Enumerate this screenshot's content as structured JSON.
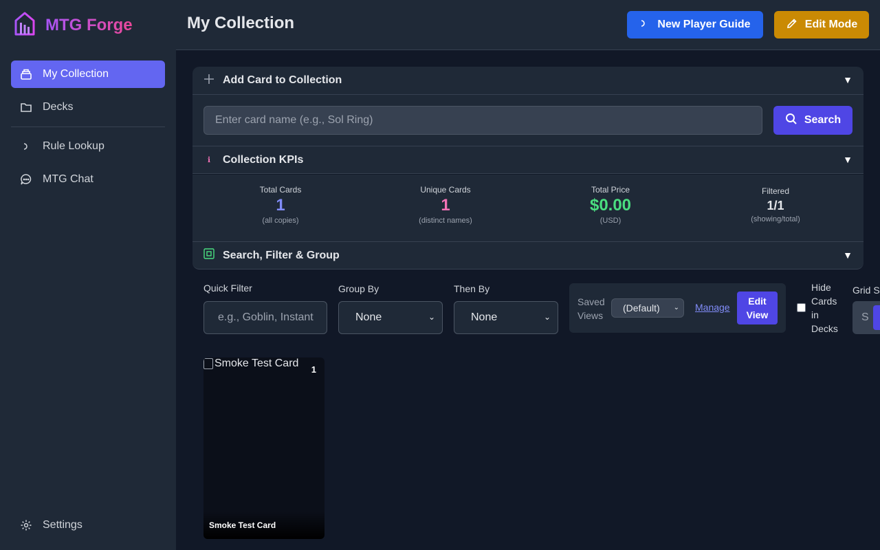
{
  "app": {
    "brand": "MTG Forge",
    "accent": "#6366f1"
  },
  "sidebar": {
    "items": [
      {
        "label": "My Collection",
        "icon": "collection-icon",
        "active": true
      },
      {
        "label": "Decks",
        "icon": "folder-icon"
      },
      {
        "label": "Rule Lookup",
        "icon": "refresh-icon"
      },
      {
        "label": "MTG Chat",
        "icon": "chat-icon"
      }
    ],
    "settings": "Settings"
  },
  "header": {
    "title": "My Collection",
    "guide_button": "New Player Guide",
    "edit_button": "Edit Mode"
  },
  "add_card": {
    "title": "Add Card to Collection",
    "placeholder": "Enter card name (e.g., Sol Ring)",
    "search_button": "Search"
  },
  "kpis": {
    "title": "Collection KPIs",
    "items": [
      {
        "label": "Total Cards",
        "value": "1",
        "sub": "(all copies)",
        "color": "#818cf8"
      },
      {
        "label": "Unique Cards",
        "value": "1",
        "sub": "(distinct names)",
        "color": "#f472b6"
      },
      {
        "label": "Total Price",
        "value": "$0.00",
        "sub": "(USD)",
        "color": "#4ade80"
      },
      {
        "label": "Filtered",
        "value": "1/1",
        "sub": "(showing/total)",
        "color": "#e5e7eb"
      }
    ]
  },
  "filters": {
    "title": "Search, Filter & Group",
    "quick_filter_label": "Quick Filter",
    "quick_filter_placeholder": "e.g., Goblin, Instant",
    "group_by_label": "Group By",
    "group_by_value": "None",
    "then_by_label": "Then By",
    "then_by_value": "None",
    "saved_views_label": "Saved Views",
    "saved_views_value": "(Default)",
    "manage": "Manage",
    "edit_view": "Edit View",
    "hide_cards_label": "Hide Cards in Decks",
    "grid_label": "Grid Size",
    "grid_value": "S"
  },
  "cards": [
    {
      "name": "Smoke Test Card",
      "alt": "Smoke Test Card",
      "count": "1"
    }
  ]
}
